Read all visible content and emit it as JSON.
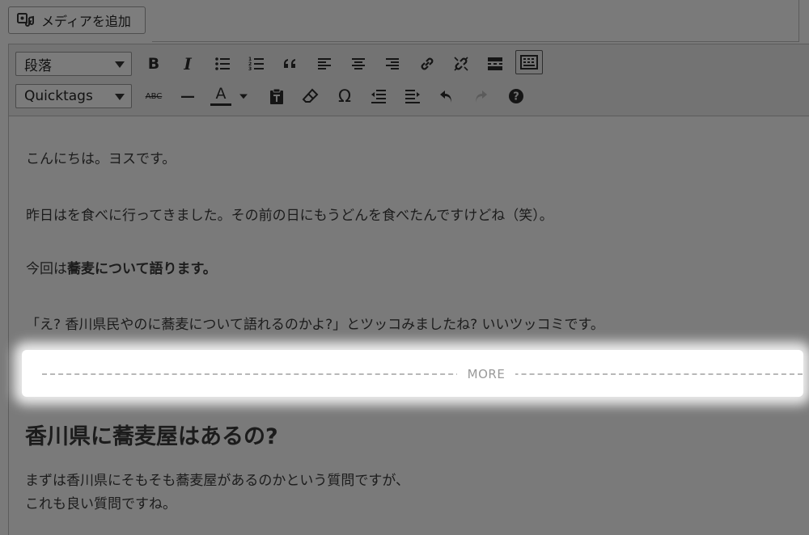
{
  "media_button": {
    "label": "メディアを追加",
    "icon": "media-icon"
  },
  "toolbar": {
    "format_select": "段落",
    "quicktags_select": "Quicktags",
    "row1": [
      "bold-icon",
      "italic-icon",
      "bullet-list-icon",
      "numbered-list-icon",
      "blockquote-icon",
      "align-left-icon",
      "align-center-icon",
      "align-right-icon",
      "link-icon",
      "unlink-icon",
      "read-more-icon",
      "toolbar-toggle-icon"
    ],
    "row2": [
      "strikethrough-icon",
      "horizontal-line-icon",
      "text-color-icon",
      "paste-text-icon",
      "clear-formatting-icon",
      "special-character-icon",
      "outdent-icon",
      "indent-icon",
      "undo-icon",
      "redo-icon",
      "help-icon"
    ],
    "bold_glyph": "B",
    "italic_glyph": "I",
    "strike_glyph": "ABC",
    "hr_glyph": "—",
    "color_glyph": "A",
    "omega_glyph": "Ω",
    "help_glyph": "?"
  },
  "content": {
    "p1": "こんにちは。ヨスです。",
    "p2": "昨日はを食べに行ってきました。その前の日にもうどんを食べたんですけどね（笑）。",
    "p3_prefix": "今回は",
    "p3_bold": "蕎麦について語ります。",
    "p4": "「え? 香川県民やのに蕎麦について語れるのかよ?」とツッコみましたね? いいツッコミです。",
    "more_label": "MORE",
    "heading": "香川県に蕎麦屋はあるの?",
    "p5_line1": "まずは香川県にそもそも蕎麦屋があるのかという質問ですが、",
    "p5_line2": "これも良い質問ですね。"
  },
  "colors": {
    "overlay": "#7a7a7a",
    "highlight": "#ffffff",
    "more_text": "#9a9a9a"
  }
}
